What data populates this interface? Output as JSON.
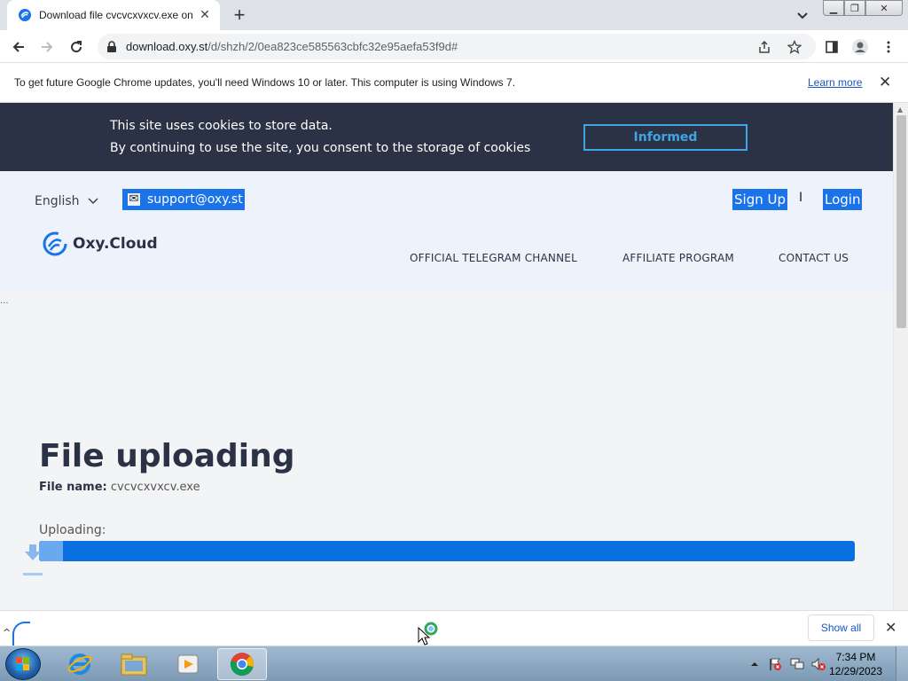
{
  "browser": {
    "tab_title": "Download file cvcvcxvxcv.exe on",
    "url_host": "download.oxy.st",
    "url_path": "/d/shzh/2/0ea823ce585563cbfc32e95aefa53f9d#",
    "new_tab": "+"
  },
  "infobar": {
    "message": "To get future Google Chrome updates, you'll need Windows 10 or later. This computer is using Windows 7.",
    "learn_more": "Learn more",
    "close": "✕"
  },
  "cookie": {
    "line1": "This site uses cookies to store data.",
    "line2": "By continuing to use the site, you consent to the storage of cookies",
    "button": "Informed"
  },
  "header": {
    "language": "English",
    "email": "support@oxy.st",
    "sign_up": "Sign Up",
    "separator": "I",
    "login": "Login",
    "brand": "Oxy.Cloud",
    "nav": [
      "OFFICIAL TELEGRAM CHANNEL",
      "AFFILIATE PROGRAM",
      "CONTACT US"
    ]
  },
  "ellipsis": "...",
  "main": {
    "title": "File uploading",
    "file_name_label": "File name:",
    "file_name": "cvcvcxvxcv.exe",
    "uploading_label": "Uploading:",
    "progress": 1.0
  },
  "shelf": {
    "show_all": "Show all",
    "close": "✕"
  },
  "taskbar": {
    "time": "7:34 PM",
    "date": "12/29/2023",
    "apps": [
      "internet-explorer",
      "windows-explorer",
      "media-player",
      "chrome"
    ]
  },
  "colors": {
    "accent": "#1a73e8",
    "progress": "#0a6fe0",
    "dark": "#2b3245",
    "cookie_button": "#3fa6e6"
  }
}
